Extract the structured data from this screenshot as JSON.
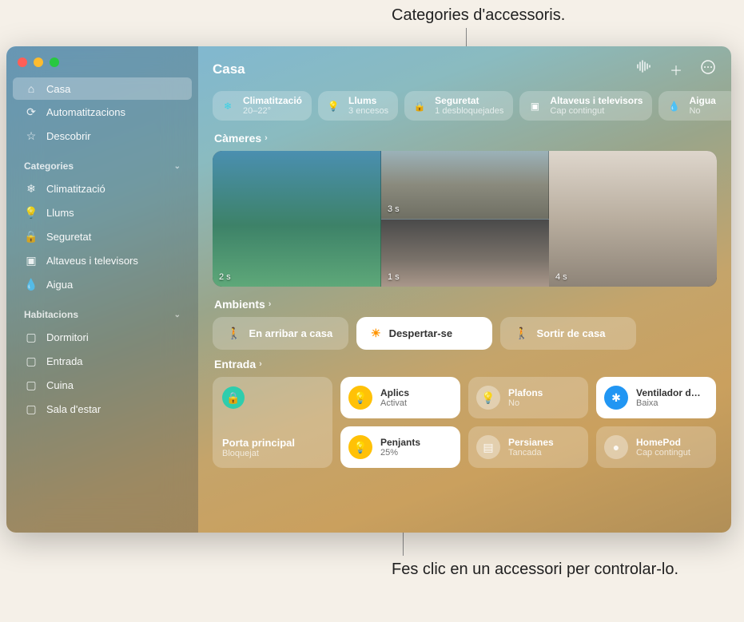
{
  "annotations": {
    "top": "Categories d'accessoris.",
    "bottom": "Fes clic en un accessori per controlar-lo."
  },
  "header": {
    "title": "Casa"
  },
  "sidebar": {
    "main": [
      {
        "label": "Casa",
        "icon": "⌂",
        "selected": true
      },
      {
        "label": "Automatitzacions",
        "icon": "⟳",
        "selected": false
      },
      {
        "label": "Descobrir",
        "icon": "☆",
        "selected": false
      }
    ],
    "categories_header": "Categories",
    "categories": [
      {
        "label": "Climatització",
        "icon": "❄"
      },
      {
        "label": "Llums",
        "icon": "💡"
      },
      {
        "label": "Seguretat",
        "icon": "🔒"
      },
      {
        "label": "Altaveus i televisors",
        "icon": "▣"
      },
      {
        "label": "Aigua",
        "icon": "💧"
      }
    ],
    "rooms_header": "Habitacions",
    "rooms": [
      {
        "label": "Dormitori"
      },
      {
        "label": "Entrada"
      },
      {
        "label": "Cuina"
      },
      {
        "label": "Sala d'estar"
      }
    ]
  },
  "category_pills": [
    {
      "title": "Climatització",
      "subtitle": "20–22°",
      "icon": "❄",
      "color": "#39d2e6"
    },
    {
      "title": "Llums",
      "subtitle": "3 encesos",
      "icon": "💡",
      "color": "#ffd23f"
    },
    {
      "title": "Seguretat",
      "subtitle": "1 desbloquejades",
      "icon": "🔒",
      "color": "#2ecdad"
    },
    {
      "title": "Altaveus i televisors",
      "subtitle": "Cap contingut",
      "icon": "▣",
      "color": "#ffffff"
    },
    {
      "title": "Aigua",
      "subtitle": "No",
      "icon": "💧",
      "color": "#2196f3"
    }
  ],
  "sections": {
    "cameras": "Càmeres",
    "scenes": "Ambients",
    "entrance": "Entrada"
  },
  "cameras": {
    "pool": "2 s",
    "driveway": "3 s",
    "bedroom": "1 s",
    "living": "4 s"
  },
  "scenes": [
    {
      "label": "En arribar a casa",
      "active": false,
      "icon": "🚶"
    },
    {
      "label": "Despertar-se",
      "active": true,
      "icon": "☀"
    },
    {
      "label": "Sortir de casa",
      "active": false,
      "icon": "🚶"
    }
  ],
  "entrance": {
    "lock": {
      "title": "Porta principal",
      "subtitle": "Bloquejat"
    },
    "tiles": [
      [
        {
          "title": "Aplics",
          "subtitle": "Activat",
          "state": "on",
          "icon": "💡"
        },
        {
          "title": "Penjants",
          "subtitle": "25%",
          "state": "on",
          "icon": "💡"
        }
      ],
      [
        {
          "title": "Plafons",
          "subtitle": "No",
          "state": "off",
          "icon": "💡"
        },
        {
          "title": "Persianes",
          "subtitle": "Tancada",
          "state": "off",
          "icon": "▤"
        }
      ],
      [
        {
          "title": "Ventilador d…",
          "subtitle": "Baixa",
          "state": "on",
          "icon": "✱",
          "variant": "fan"
        },
        {
          "title": "HomePod",
          "subtitle": "Cap contingut",
          "state": "off",
          "icon": "●"
        }
      ]
    ]
  }
}
